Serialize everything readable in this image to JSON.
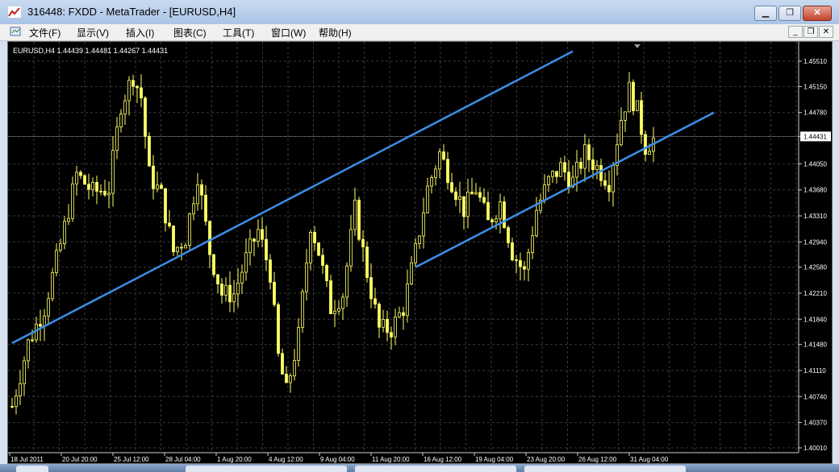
{
  "window": {
    "title": "316448: FXDD - MetaTrader - [EURUSD,H4]",
    "min_label": "▁",
    "max_label": "❐",
    "close_label": "✕"
  },
  "menu": {
    "items": [
      "文件(F)",
      "显示(V)",
      "插入(I)",
      "图表(C)",
      "工具(T)",
      "窗口(W)",
      "帮助(H)"
    ],
    "mdi_min": "_",
    "mdi_restore": "❐",
    "mdi_close": "✕"
  },
  "chart": {
    "info": "EURUSD,H4  1.44439 1.44481 1.44267 1.44431",
    "current_price": "1.44431",
    "colors": {
      "candle": "#ffff66",
      "trendline": "#3b8ee8",
      "grid": "#3a3a3a",
      "text": "#ffffff",
      "background": "#000000"
    }
  },
  "chart_data": {
    "type": "candlestick",
    "symbol": "EURUSD",
    "timeframe": "H4",
    "y_ticks": [
      1.4551,
      1.4515,
      1.4478,
      1.4444,
      1.4405,
      1.4368,
      1.4331,
      1.4294,
      1.4258,
      1.4221,
      1.4184,
      1.4148,
      1.4111,
      1.4074,
      1.4037,
      1.4001
    ],
    "y_tick_labels": [
      "1.45510",
      "1.45150",
      "1.44780",
      "1.44431",
      "1.44050",
      "1.43680",
      "1.43310",
      "1.42940",
      "1.42580",
      "1.42210",
      "1.41840",
      "1.41480",
      "1.41110",
      "1.40740",
      "1.40370",
      "1.40010"
    ],
    "ylim": [
      1.4001,
      1.4551
    ],
    "x_labels": [
      "18 Jul 2011",
      "20 Jul 20:00",
      "25 Jul 12:00",
      "28 Jul 04:00",
      "1 Aug 20:00",
      "4 Aug 12:00",
      "9 Aug 04:00",
      "11 Aug 20:00",
      "16 Aug 12:00",
      "19 Aug 04:00",
      "23 Aug 20:00",
      "26 Aug 12:00",
      "31 Aug 04:00"
    ],
    "price_path": [
      [
        0,
        1.406
      ],
      [
        4,
        1.415
      ],
      [
        8,
        1.42
      ],
      [
        12,
        1.429
      ],
      [
        16,
        1.439
      ],
      [
        20,
        1.4365
      ],
      [
        24,
        1.437
      ],
      [
        27,
        1.449
      ],
      [
        30,
        1.453
      ],
      [
        32,
        1.45
      ],
      [
        34,
        1.439
      ],
      [
        37,
        1.436
      ],
      [
        40,
        1.428
      ],
      [
        43,
        1.43
      ],
      [
        46,
        1.439
      ],
      [
        49,
        1.428
      ],
      [
        52,
        1.422
      ],
      [
        55,
        1.422
      ],
      [
        58,
        1.427
      ],
      [
        61,
        1.431
      ],
      [
        64,
        1.425
      ],
      [
        66,
        1.413
      ],
      [
        68,
        1.408
      ],
      [
        71,
        1.416
      ],
      [
        74,
        1.432
      ],
      [
        76,
        1.428
      ],
      [
        79,
        1.42
      ],
      [
        82,
        1.422
      ],
      [
        85,
        1.434
      ],
      [
        88,
        1.425
      ],
      [
        91,
        1.417
      ],
      [
        94,
        1.417
      ],
      [
        97,
        1.42
      ],
      [
        100,
        1.428
      ],
      [
        103,
        1.437
      ],
      [
        106,
        1.442
      ],
      [
        109,
        1.438
      ],
      [
        112,
        1.434
      ],
      [
        115,
        1.437
      ],
      [
        118,
        1.432
      ],
      [
        121,
        1.435
      ],
      [
        124,
        1.428
      ],
      [
        127,
        1.425
      ],
      [
        130,
        1.434
      ],
      [
        133,
        1.438
      ],
      [
        136,
        1.44
      ],
      [
        139,
        1.438
      ],
      [
        142,
        1.442
      ],
      [
        145,
        1.44
      ],
      [
        148,
        1.438
      ],
      [
        151,
        1.447
      ],
      [
        153,
        1.451
      ],
      [
        155,
        1.448
      ],
      [
        157,
        1.443
      ],
      [
        159,
        1.444
      ]
    ],
    "trendlines": [
      {
        "from": [
          0,
          1.415
        ],
        "to": [
          139,
          1.4565
        ]
      },
      {
        "from": [
          100,
          1.4258
        ],
        "to": [
          174,
          1.4478
        ]
      }
    ]
  }
}
